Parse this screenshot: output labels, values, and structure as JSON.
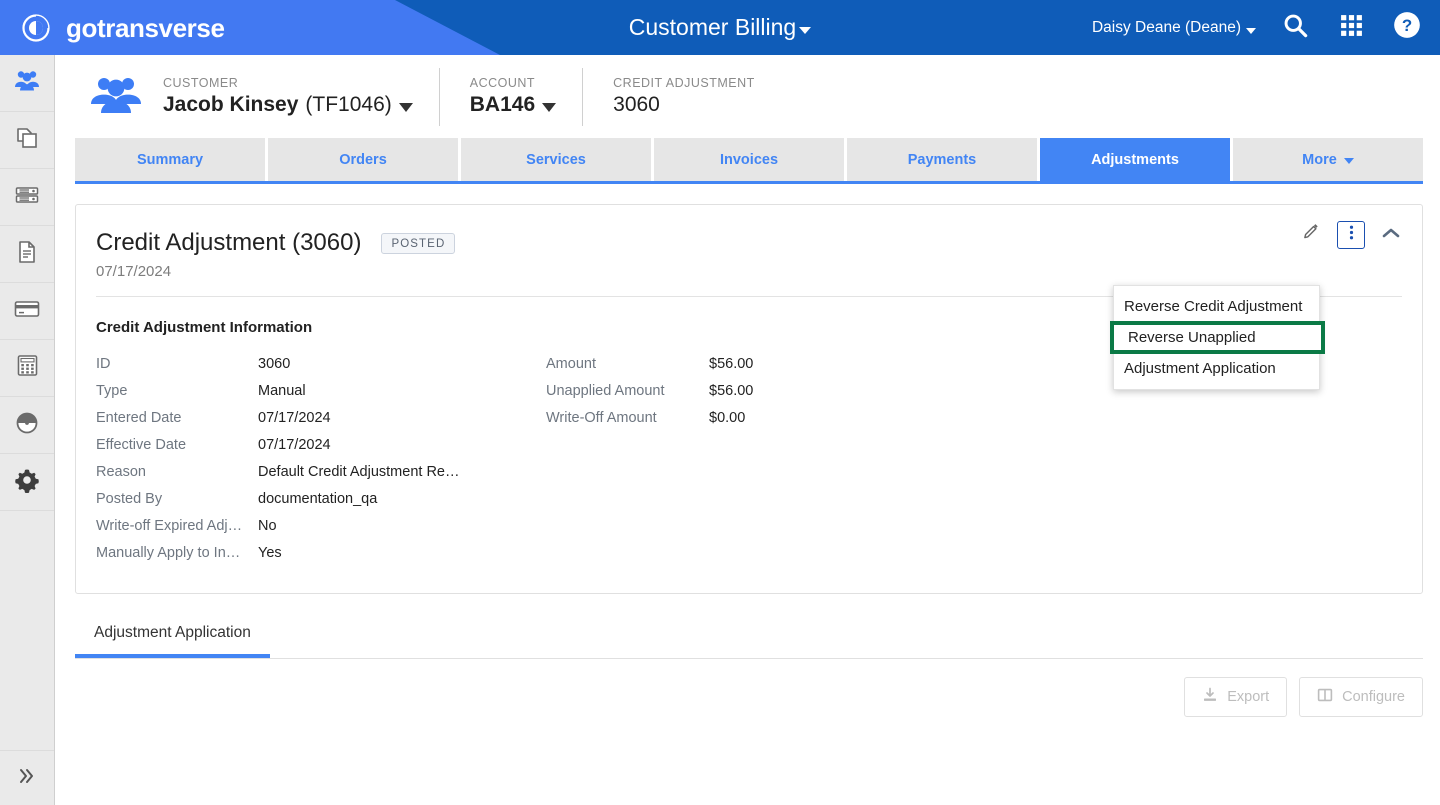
{
  "topbar": {
    "brand": "gotransverse",
    "brand_logo_icon": "circular-arrow-logo-icon",
    "app_title": "Customer Billing",
    "app_title_caret_icon": "caret-down-icon",
    "user": "Daisy Deane (Deane)",
    "user_caret_icon": "caret-down-icon",
    "search_icon": "search-icon",
    "apps_icon": "grid-apps-icon",
    "help_icon": "help-circle-icon",
    "color_light": "#4279f2",
    "color_dark": "#0f5cb8"
  },
  "sidebar": {
    "items": [
      {
        "icon": "customers-group-icon",
        "active": true
      },
      {
        "icon": "copy-documents-icon",
        "active": false
      },
      {
        "icon": "servers-stack-icon",
        "active": false
      },
      {
        "icon": "invoice-document-icon",
        "active": false
      },
      {
        "icon": "credit-card-icon",
        "active": false
      },
      {
        "icon": "calculator-icon",
        "active": false
      },
      {
        "icon": "dashboard-gauge-icon",
        "active": false
      },
      {
        "icon": "settings-gear-icon",
        "active": false
      }
    ],
    "expand_icon": "double-chevron-right-icon"
  },
  "breadcrumb": {
    "avatar_icon": "customers-group-icon",
    "customer": {
      "label": "CUSTOMER",
      "name": "Jacob Kinsey",
      "code": "(TF1046)",
      "caret_icon": "caret-down-icon"
    },
    "account": {
      "label": "ACCOUNT",
      "value": "BA146",
      "caret_icon": "caret-down-icon"
    },
    "credit_adjustment": {
      "label": "CREDIT ADJUSTMENT",
      "value": "3060"
    }
  },
  "tabs": [
    {
      "label": "Summary",
      "active": false
    },
    {
      "label": "Orders",
      "active": false
    },
    {
      "label": "Services",
      "active": false
    },
    {
      "label": "Invoices",
      "active": false
    },
    {
      "label": "Payments",
      "active": false
    },
    {
      "label": "Adjustments",
      "active": true
    },
    {
      "label": "More",
      "active": false,
      "caret_icon": "caret-down-icon"
    }
  ],
  "card": {
    "title": "Credit Adjustment (3060)",
    "status_badge": "POSTED",
    "date": "07/17/2024",
    "actions": {
      "edit_icon": "pencil-edit-icon",
      "more_icon": "vertical-dots-more-icon",
      "collapse_icon": "chevron-up-icon"
    },
    "section_title": "Credit Adjustment Information",
    "fields_left": [
      {
        "label": "ID",
        "value": "3060"
      },
      {
        "label": "Type",
        "value": "Manual"
      },
      {
        "label": "Entered Date",
        "value": "07/17/2024"
      },
      {
        "label": "Effective Date",
        "value": "07/17/2024"
      },
      {
        "label": "Reason",
        "value": "Default Credit Adjustment Re…"
      },
      {
        "label": "Posted By",
        "value": "documentation_qa"
      },
      {
        "label": "Write-off Expired Adj…",
        "value": "No"
      },
      {
        "label": "Manually Apply to In…",
        "value": "Yes"
      }
    ],
    "fields_right": [
      {
        "label": "Amount",
        "value": "$56.00"
      },
      {
        "label": "Unapplied Amount",
        "value": "$56.00"
      },
      {
        "label": "Write-Off Amount",
        "value": "$0.00"
      }
    ]
  },
  "dropdown": {
    "items": [
      {
        "label": "Reverse Credit Adjustment",
        "highlighted": false
      },
      {
        "label": "Reverse Unapplied",
        "highlighted": true
      },
      {
        "label": "Adjustment Application",
        "highlighted": false
      }
    ],
    "highlight_color": "#0b7a46"
  },
  "bottom": {
    "subtab": "Adjustment Application",
    "export_button": "Export",
    "export_icon": "download-export-icon",
    "configure_button": "Configure",
    "configure_icon": "columns-configure-icon"
  }
}
